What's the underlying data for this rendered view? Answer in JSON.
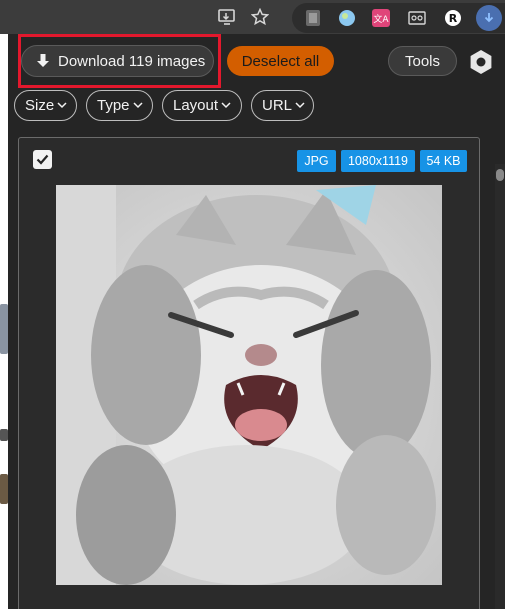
{
  "browser_toolbar": {
    "icons": [
      "cast-icon",
      "bookmark-star-icon"
    ],
    "extensions": [
      "reading-mode-icon",
      "globe-extension-icon",
      "translate-extension-icon",
      "screen-capture-icon",
      "r-extension-icon",
      "download-extension-icon"
    ],
    "r_extension_label": "R"
  },
  "header": {
    "download_label": "Download 119 images",
    "deselect_label": "Deselect all",
    "tools_label": "Tools",
    "settings_icon": "gear-icon"
  },
  "filters": [
    {
      "label": "Size"
    },
    {
      "label": "Type"
    },
    {
      "label": "Layout"
    },
    {
      "label": "URL"
    }
  ],
  "card": {
    "checked": true,
    "badges": {
      "type": "JPG",
      "dimensions": "1080x1119",
      "filesize": "54 KB"
    },
    "image_subject": "laughing kitten photo"
  },
  "colors": {
    "accent_orange": "#d35e00",
    "badge_blue": "#1793e6",
    "highlight_red": "#e3182d"
  }
}
